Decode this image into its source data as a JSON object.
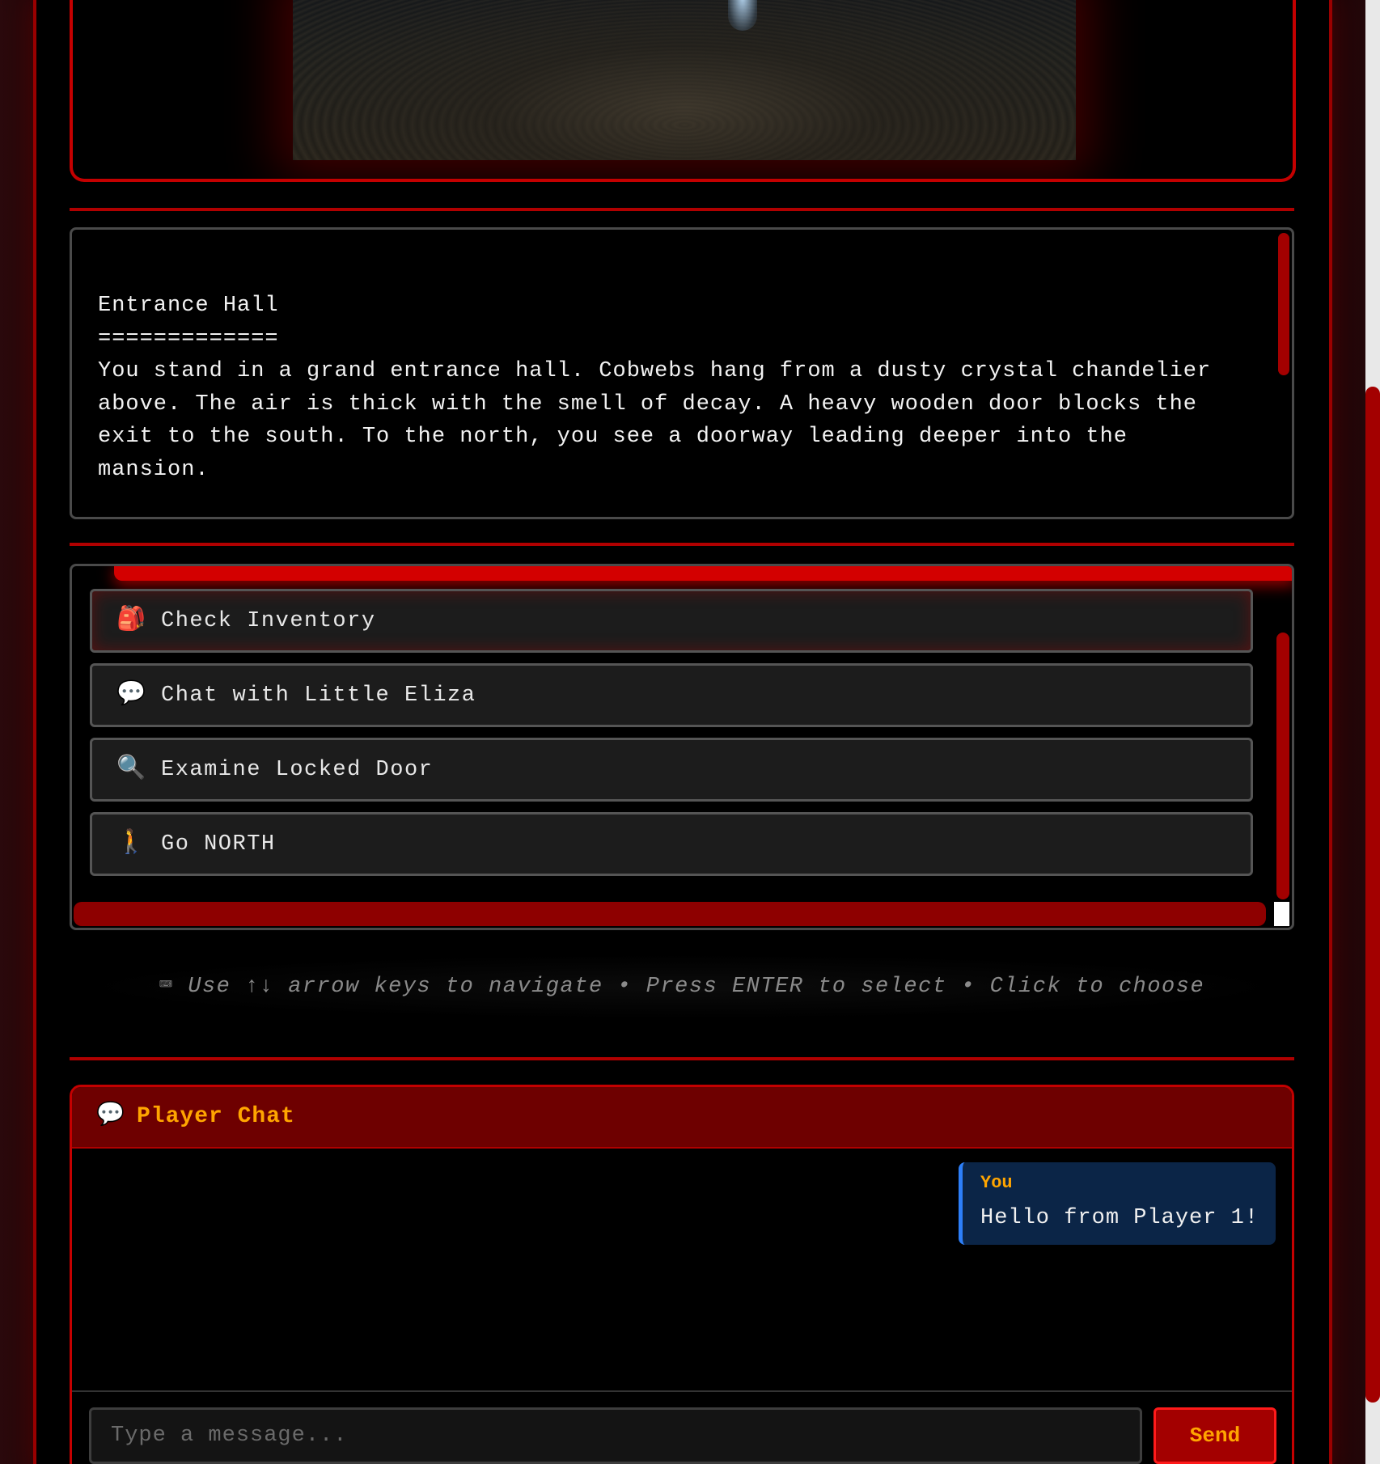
{
  "location": {
    "title": "Entrance Hall",
    "underline": "=============",
    "description": "You stand in a grand entrance hall. Cobwebs hang from a dusty crystal chandelier above. The air is thick with the smell of decay. A heavy wooden door blocks the exit to the south. To the north, you see a doorway leading deeper into the mansion."
  },
  "choices": [
    {
      "icon": "🎒",
      "icon_name": "backpack-icon",
      "label": "Check Inventory"
    },
    {
      "icon": "💬",
      "icon_name": "speech-bubble-icon",
      "label": "Chat with Little Eliza"
    },
    {
      "icon": "🔍",
      "icon_name": "magnifying-glass-icon",
      "label": "Examine Locked Door"
    },
    {
      "icon": "🚶",
      "icon_name": "walking-person-icon",
      "label": "Go NORTH"
    }
  ],
  "hint": {
    "icon": "⌨",
    "icon_name": "keyboard-icon",
    "text": "Use ↑↓ arrow keys to navigate • Press ENTER to select • Click to choose"
  },
  "chat": {
    "header_icon": "💬",
    "title": "Player Chat",
    "messages": [
      {
        "author": "You",
        "text": "Hello from Player 1!"
      }
    ],
    "input_placeholder": "Type a message...",
    "send_label": "Send"
  },
  "colors": {
    "accent_red": "#c40000",
    "header_red": "#6e0000",
    "highlight_orange": "#ffa500",
    "message_blue": "#0b2547",
    "message_border_blue": "#2d7ff9"
  }
}
